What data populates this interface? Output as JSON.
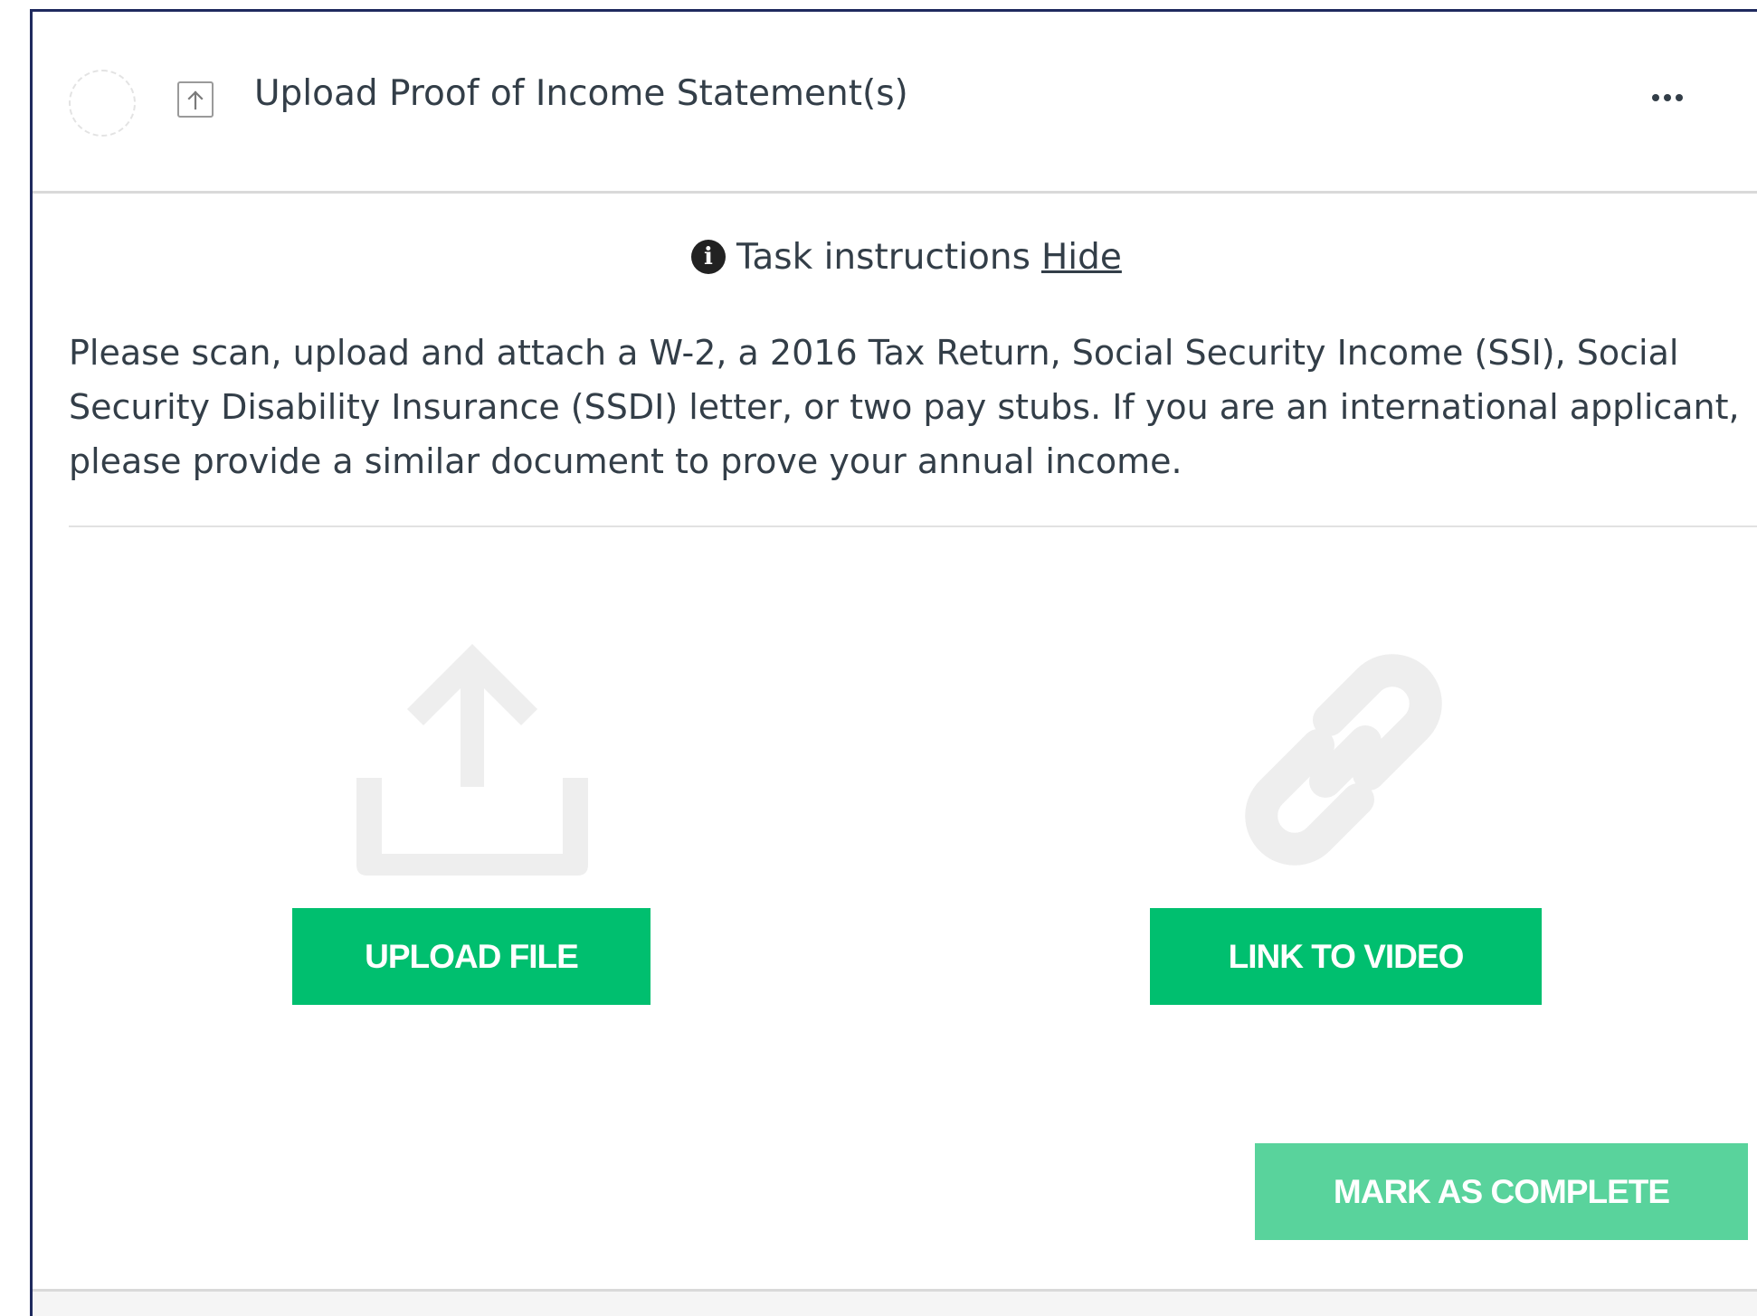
{
  "task": {
    "title": "Upload Proof of Income Statement(s)",
    "type_icon": "upload-arrow-icon",
    "status_icon": "incomplete-circle-icon",
    "menu_icon": "more-horizontal-icon"
  },
  "instructions": {
    "label": "Task instructions",
    "toggle_label": "Hide",
    "info_icon_glyph": "i",
    "body": "Please scan, upload and attach a W-2, a 2016 Tax Return, Social Security Income (SSI), Social Security Disability Insurance (SSDI) letter, or two pay stubs. If you are an international applicant, please provide a similar document to prove your annual income."
  },
  "actions": {
    "upload_label": "UPLOAD FILE",
    "link_label": "LINK TO VIDEO",
    "complete_label": "MARK AS COMPLETE"
  },
  "colors": {
    "primary_green": "#00bf6f",
    "disabled_green": "#59d39c",
    "text": "#333e48",
    "illustration_gray": "#eeeeee",
    "frame_border": "#1f2a5e"
  }
}
